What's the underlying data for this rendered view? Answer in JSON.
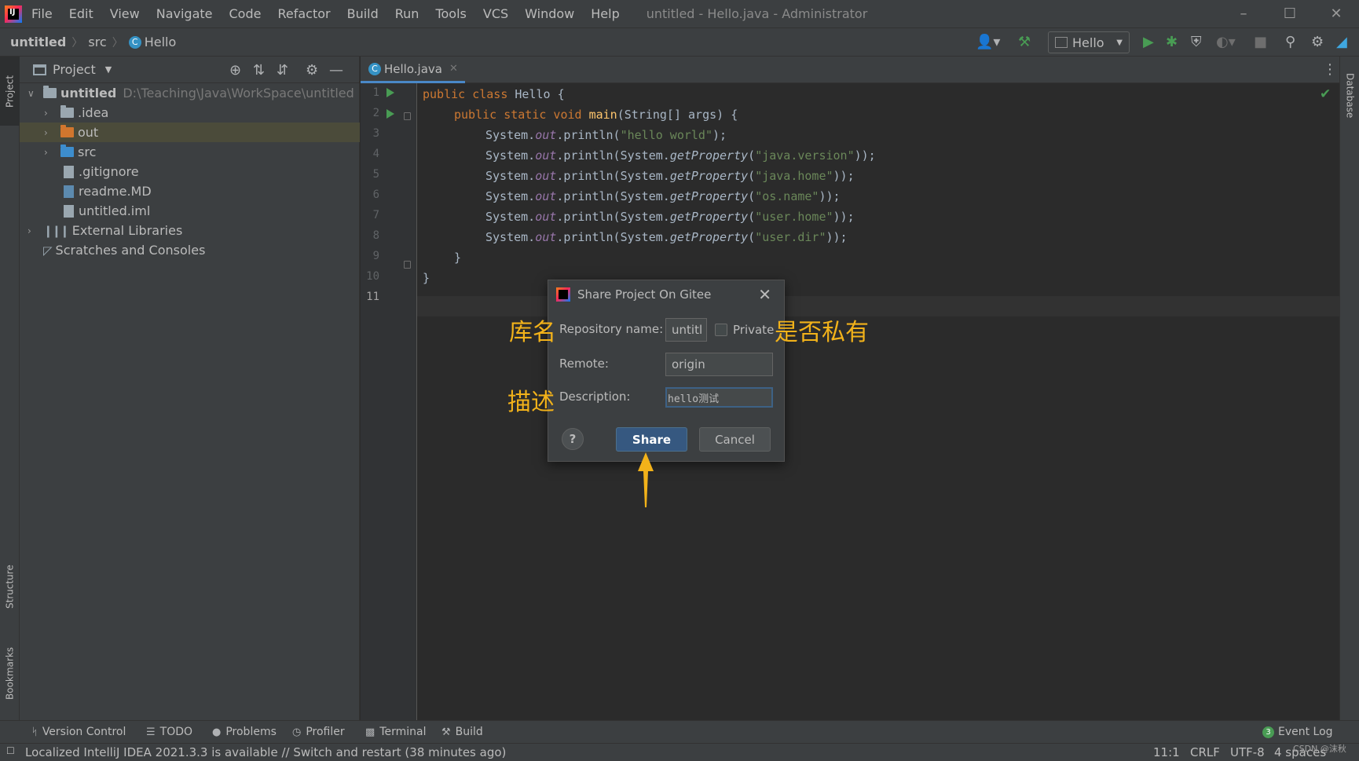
{
  "menubar": {
    "logo_text": "IJ",
    "items": [
      "File",
      "Edit",
      "View",
      "Navigate",
      "Code",
      "Refactor",
      "Build",
      "Run",
      "Tools",
      "VCS",
      "Window",
      "Help"
    ],
    "window_title": "untitled - Hello.java - Administrator"
  },
  "breadcrumb": {
    "project": "untitled",
    "folder": "src",
    "file": "Hello",
    "file_icon": "C"
  },
  "run_config": {
    "name": "Hello"
  },
  "left_strip": {
    "project_tab": "Project",
    "structure_tab": "Structure",
    "bookmarks_tab": "Bookmarks"
  },
  "right_strip": {
    "database_tab": "Database"
  },
  "project_panel": {
    "title": "Project",
    "tree": [
      {
        "label": "untitled",
        "path": "D:\\Teaching\\Java\\WorkSpace\\untitled",
        "icon": "module-folder",
        "expanded": true
      },
      {
        "label": ".idea",
        "icon": "folder",
        "expanded": false
      },
      {
        "label": "out",
        "icon": "folder-orange",
        "expanded": false,
        "selected": true
      },
      {
        "label": "src",
        "icon": "folder-blue",
        "expanded": false
      },
      {
        "label": ".gitignore",
        "icon": "gitignore-file"
      },
      {
        "label": "readme.MD",
        "icon": "markdown-file"
      },
      {
        "label": "untitled.iml",
        "icon": "iml-file"
      },
      {
        "label": "External Libraries",
        "icon": "libraries-icon",
        "expanded": false
      },
      {
        "label": "Scratches and Consoles",
        "icon": "scratches-icon"
      }
    ]
  },
  "editor": {
    "tab_label": "Hello.java",
    "line_numbers": [
      "1",
      "2",
      "3",
      "4",
      "5",
      "6",
      "7",
      "8",
      "9",
      "10",
      "11"
    ],
    "current_line": 11,
    "code": {
      "l1_kw": "public class ",
      "l1_name": "Hello {",
      "l2_kw": "public static void ",
      "l2_meth": "main",
      "l2_rest": "(String[] args) {",
      "sys": "System.",
      "out": "out",
      "println": ".println(",
      "getprop_prefix": "System.",
      "getprop": "getProperty",
      "s3": "\"hello world\"",
      "s4": "\"java.version\"",
      "s5": "\"java.home\"",
      "s6": "\"os.name\"",
      "s7": "\"user.home\"",
      "s8": "\"user.dir\"",
      "end1": ");",
      "end2": "));",
      "paren": "(",
      "l9": "}",
      "l10": "}"
    }
  },
  "dialog": {
    "title": "Share Project On Gitee",
    "repo_label": "Repository name:",
    "repo_value": "untitl",
    "private_label": "Private",
    "private_checked": false,
    "remote_label": "Remote:",
    "remote_value": "origin",
    "description_label": "Description:",
    "description_value": "hello测试",
    "help_label": "?",
    "share_label": "Share",
    "cancel_label": "Cancel"
  },
  "annotations": {
    "repo_name": "库名",
    "is_private": "是否私有",
    "description": "描述"
  },
  "tool_windows": {
    "items": [
      "Version Control",
      "TODO",
      "Problems",
      "Profiler",
      "Terminal",
      "Build"
    ],
    "event_log": "Event Log",
    "event_count": "3"
  },
  "status_bar": {
    "message": "Localized IntelliJ IDEA 2021.3.3 is available // Switch and restart (38 minutes ago)",
    "position": "11:1",
    "line_sep": "CRLF",
    "encoding": "UTF-8",
    "indent": "4 spaces"
  },
  "watermark": "CSDN @沫秋",
  "colors": {
    "background": "#2b2b2b",
    "panel": "#3c3f41",
    "accent": "#365880",
    "keyword": "#cc7832",
    "string": "#6a8759",
    "annotation": "#f2b21a",
    "run_green": "#499c54"
  }
}
